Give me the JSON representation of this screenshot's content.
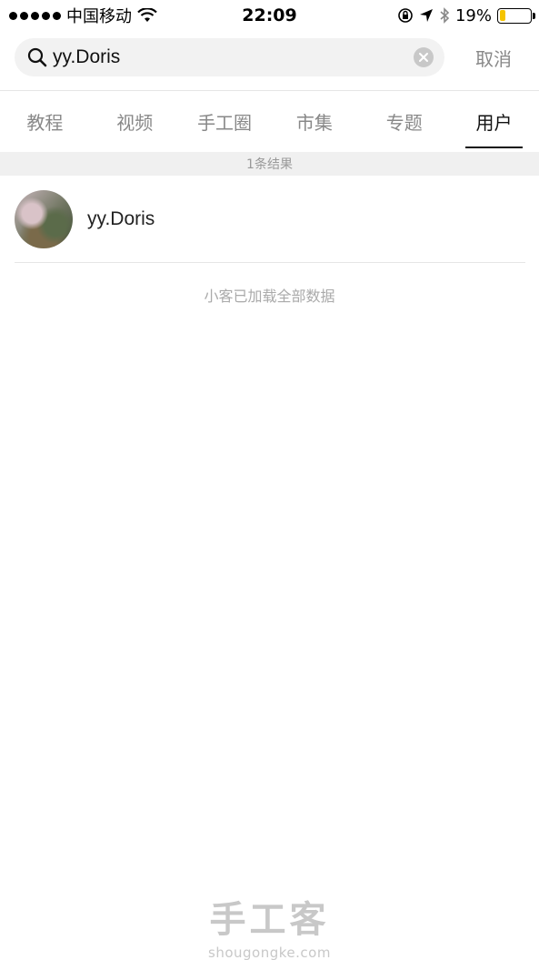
{
  "status_bar": {
    "carrier": "中国移动",
    "time": "22:09",
    "battery_percent": "19%",
    "battery_level": 0.19
  },
  "search": {
    "query": "yy.Doris",
    "cancel_label": "取消"
  },
  "tabs": [
    {
      "label": "教程",
      "active": false
    },
    {
      "label": "视频",
      "active": false
    },
    {
      "label": "手工圈",
      "active": false
    },
    {
      "label": "市集",
      "active": false
    },
    {
      "label": "专题",
      "active": false
    },
    {
      "label": "用户",
      "active": true
    }
  ],
  "results": {
    "count_text": "1条结果",
    "users": [
      {
        "name": "yy.Doris"
      }
    ],
    "loaded_text": "小客已加载全部数据"
  },
  "watermark": {
    "title": "手工客",
    "url": "shougongke.com"
  },
  "colors": {
    "battery_fill": "#f5c400",
    "active_tab": "#111111",
    "inactive_tab": "#888888"
  }
}
